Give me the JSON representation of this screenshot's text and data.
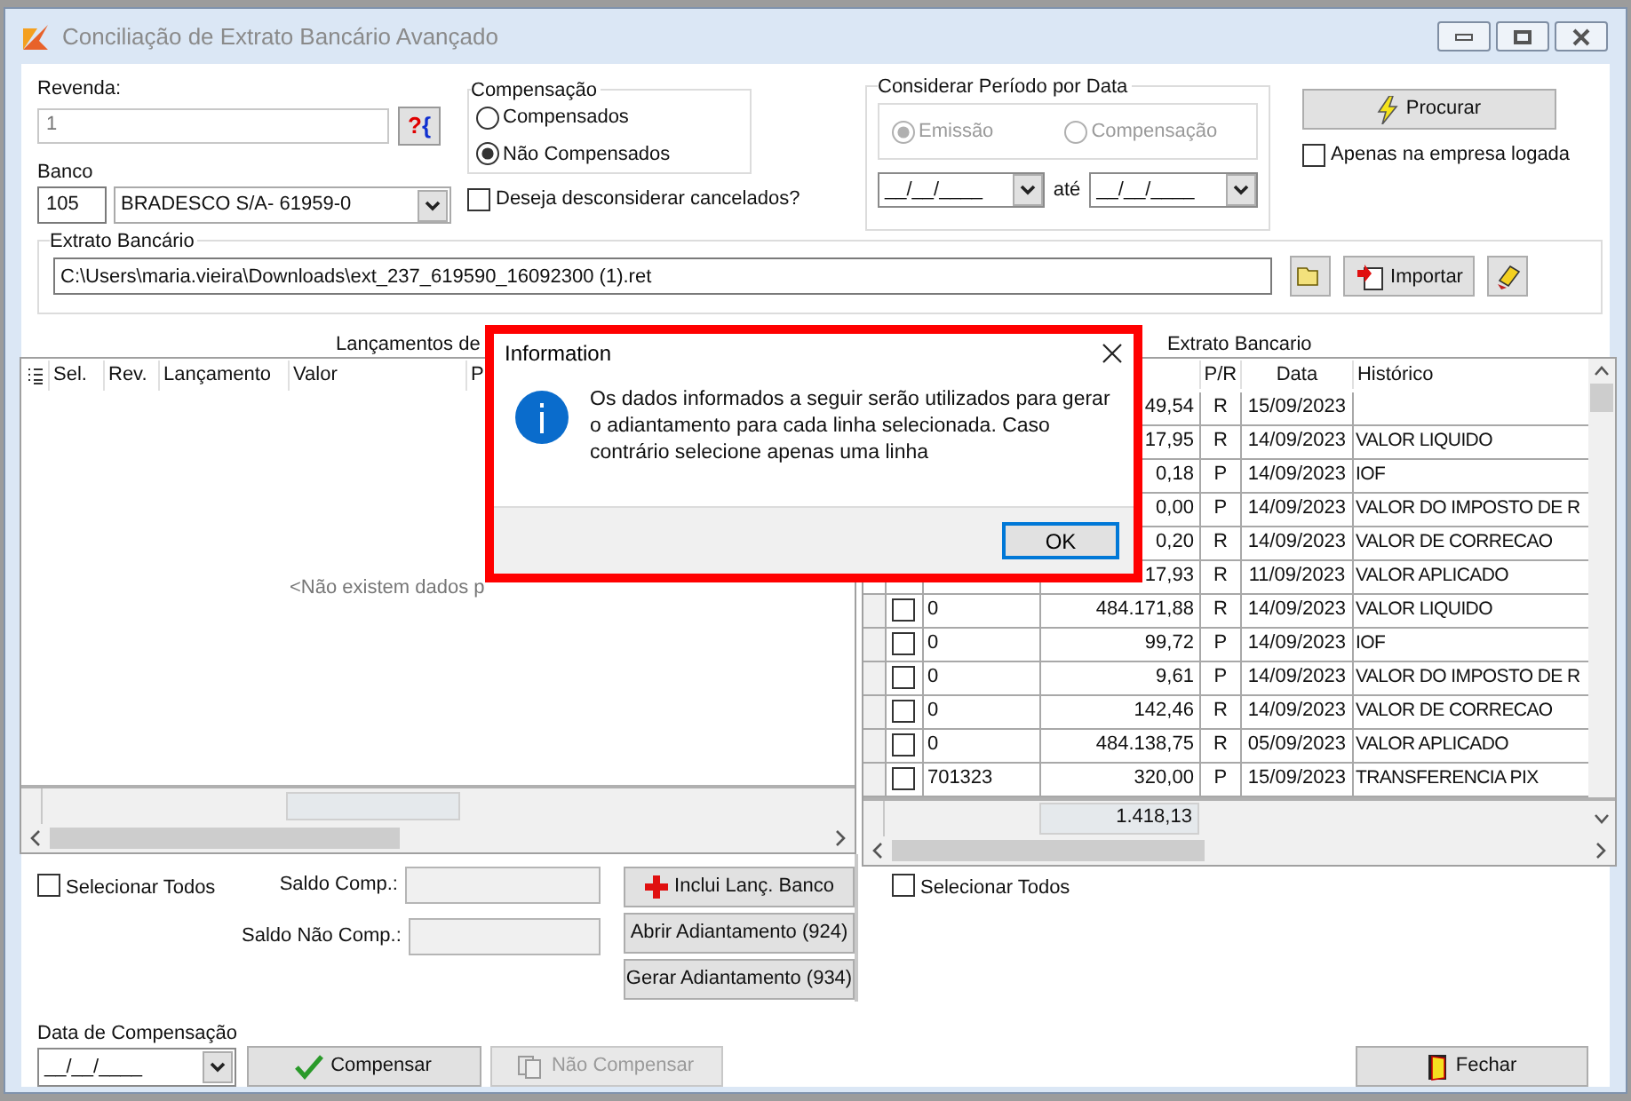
{
  "window": {
    "title": "Conciliação de Extrato Bancário Avançado"
  },
  "revenda": {
    "label": "Revenda:",
    "value": "1",
    "disabled": true,
    "lookup_button": [
      "?",
      "{"
    ]
  },
  "banco": {
    "label": "Banco",
    "code": "105",
    "name": "BRADESCO S/A- 61959-0"
  },
  "compensacao": {
    "title": "Compensação",
    "options": [
      {
        "label": "Compensados",
        "selected": false
      },
      {
        "label": "Não Compensados",
        "selected": true
      }
    ]
  },
  "desconsiderar_cancelados": {
    "label": "Deseja desconsiderar cancelados?",
    "checked": false
  },
  "periodo": {
    "title": "Considerar Período por Data",
    "options": [
      {
        "label": "Emissão",
        "selected": true,
        "disabled": true
      },
      {
        "label": "Compensação",
        "selected": false,
        "disabled": true
      }
    ],
    "from": "__/__/____",
    "separator": "até",
    "to": "__/__/____"
  },
  "search_button": "Procurar",
  "apenas_empresa": {
    "label": "Apenas na empresa logada",
    "checked": false
  },
  "extrato": {
    "title": "Extrato Bancário",
    "path": "C:\\Users\\maria.vieira\\Downloads\\ext_237_619590_16092300 (1).ret",
    "import_button": "Importar"
  },
  "left_grid": {
    "title": "Lançamentos de",
    "columns": [
      "Sel.",
      "Rev.",
      "Lançamento",
      "Valor",
      "P"
    ],
    "empty_message": "<Não existem dados p"
  },
  "right_grid": {
    "title": "Extrato Bancario",
    "columns": [
      "P/R",
      "Data",
      "Histórico"
    ],
    "rows": [
      {
        "value": "49,54",
        "pr": "R",
        "date": "15/09/2023"
      },
      {
        "value": "17,95",
        "pr": "R",
        "date": "14/09/2023",
        "history": "VALOR LIQUIDO"
      },
      {
        "value": "0,18",
        "pr": "P",
        "date": "14/09/2023",
        "history": "IOF"
      },
      {
        "value": "0,00",
        "pr": "P",
        "date": "14/09/2023",
        "history": "VALOR DO IMPOSTO DE R"
      },
      {
        "value": "0,20",
        "pr": "R",
        "date": "14/09/2023",
        "history": "VALOR DE CORRECAO"
      },
      {
        "value": "17,93",
        "pr": "R",
        "date": "11/09/2023",
        "history": "VALOR APLICADO"
      },
      {
        "checked": false,
        "number": "0",
        "value": "484.171,88",
        "pr": "R",
        "date": "14/09/2023",
        "history": "VALOR LIQUIDO"
      },
      {
        "checked": false,
        "number": "0",
        "value": "99,72",
        "pr": "P",
        "date": "14/09/2023",
        "history": "IOF"
      },
      {
        "checked": false,
        "number": "0",
        "value": "9,61",
        "pr": "P",
        "date": "14/09/2023",
        "history": "VALOR DO IMPOSTO DE R"
      },
      {
        "checked": false,
        "number": "0",
        "value": "142,46",
        "pr": "R",
        "date": "14/09/2023",
        "history": "VALOR DE CORRECAO"
      },
      {
        "checked": false,
        "number": "0",
        "value": "484.138,75",
        "pr": "R",
        "date": "05/09/2023",
        "history": "VALOR APLICADO"
      },
      {
        "checked": false,
        "number": "701323",
        "value": "320,00",
        "pr": "P",
        "date": "15/09/2023",
        "history": "TRANSFERENCIA PIX"
      }
    ],
    "total": "1.418,13"
  },
  "left_controls": {
    "select_all": {
      "label": "Selecionar Todos",
      "checked": false
    },
    "saldo_comp": {
      "label": "Saldo Comp.:"
    },
    "saldo_nao_comp": {
      "label": "Saldo Não Comp.:"
    },
    "buttons": [
      "Inclui Lanç. Banco",
      "Abrir Adiantamento (924)",
      "Gerar Adiantamento (934)"
    ]
  },
  "right_controls": {
    "select_all": {
      "label": "Selecionar Todos",
      "checked": false
    }
  },
  "footer": {
    "date_label": "Data de Compensação",
    "date": "__/__/____",
    "compensar": {
      "label": "Compensar",
      "disabled": false
    },
    "nao_compensar": {
      "label": "Não Compensar",
      "disabled": true
    },
    "close": "Fechar"
  },
  "dialog": {
    "title": "Information",
    "message": "Os dados informados a seguir serão utilizados para gerar o adiantamento para cada linha selecionada. Caso contrário selecione apenas uma linha",
    "ok": "OK"
  }
}
